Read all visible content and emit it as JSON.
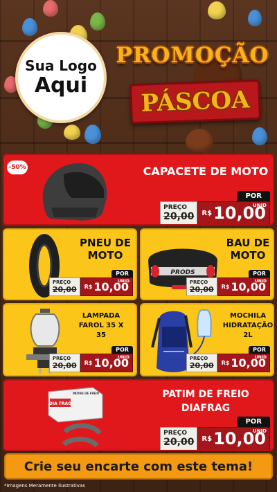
{
  "header": {
    "logo_line1": "Sua Logo",
    "logo_line2": "Aqui",
    "promo_title": "PROMOÇÃO",
    "promo_subtitle": "PÁSCOA"
  },
  "colors": {
    "red_card": "#e0181c",
    "yellow_card": "#fbc51a",
    "price_red": "#a4161a",
    "cta_orange": "#f49a12",
    "gold_text": "#f7b31b"
  },
  "products": [
    {
      "name": "CAPACETE DE MOTO",
      "badge": "-50%",
      "icon": "helmet-icon",
      "por": "POR",
      "preco_label": "PREÇO",
      "old_price": "20,00",
      "currency": "R$",
      "new_price": "10,00",
      "unit": "UNID"
    },
    {
      "name_line1": "PNEU DE",
      "name_line2": "MOTO",
      "icon": "tire-icon",
      "por": "POR",
      "preco_label": "PREÇO",
      "old_price": "20,00",
      "currency": "R$",
      "new_price": "10,00",
      "unit": "UNID"
    },
    {
      "name_line1": "BAU DE",
      "name_line2": "MOTO",
      "brand": "PRODS",
      "icon": "top-case-icon",
      "por": "POR",
      "preco_label": "PREÇO",
      "old_price": "20,00",
      "currency": "R$",
      "new_price": "10,00",
      "unit": "UNID"
    },
    {
      "name_line1": "LAMPADA",
      "name_line2": "FAROL 35 X",
      "name_line3": "35",
      "icon": "lamp-icon",
      "por": "POR",
      "preco_label": "PREÇO",
      "old_price": "20,00",
      "currency": "R$",
      "new_price": "10,00",
      "unit": "UNID"
    },
    {
      "name_line1": "MOCHILA",
      "name_line2": "HIDRATAÇÃO",
      "name_line3": "2L",
      "icon": "backpack-icon",
      "por": "POR",
      "preco_label": "PREÇO",
      "old_price": "20,00",
      "currency": "R$",
      "new_price": "10,00",
      "unit": "UNID"
    },
    {
      "name_line1": "PATIM DE FREIO",
      "name_line2": "DIAFRAG",
      "brand": "DIA FRAG",
      "box_text": "PATINS DE FREIO",
      "icon": "brake-shoe-icon",
      "por": "POR",
      "preco_label": "PREÇO",
      "old_price": "20,00",
      "currency": "R$",
      "new_price": "10,00",
      "unit": "UNID"
    }
  ],
  "cta": "Crie seu encarte com este tema!",
  "disclaimer": "*Imagens Meramente Ilustrativas"
}
